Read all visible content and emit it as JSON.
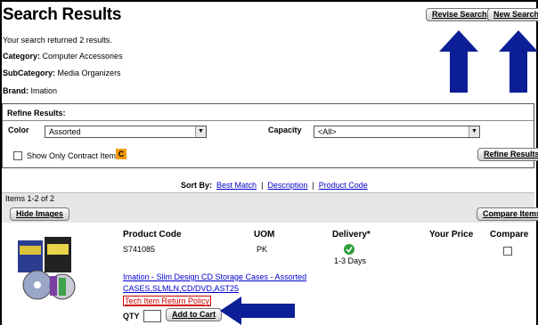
{
  "header": {
    "title": "Search Results",
    "revise_label": "Revise Search",
    "new_label": "New Search"
  },
  "summary": {
    "returned_text": "Your search returned 2 results.",
    "category_label": "Category:",
    "category_value": "Computer Accessories",
    "subcategory_label": "SubCategory:",
    "subcategory_value": "Media Organizers",
    "brand_label": "Brand:",
    "brand_value": "Imation"
  },
  "refine": {
    "title": "Refine Results:",
    "color_label": "Color",
    "color_value": "Assorted",
    "capacity_label": "Capacity",
    "capacity_value": "<All>",
    "contract_label": "Show Only Contract Items",
    "contract_badge": "C",
    "button_label": "Refine Results"
  },
  "sort": {
    "label": "Sort By:",
    "options": [
      "Best Match",
      "Description",
      "Product Code"
    ]
  },
  "results": {
    "count_text": "Items 1-2 of 2",
    "hide_images_label": "Hide Images",
    "compare_label": "Compare Items",
    "columns": [
      "Product Code",
      "UOM",
      "Delivery*",
      "Your Price",
      "Compare"
    ],
    "item": {
      "code": "S741085",
      "uom": "PK",
      "delivery": "1-3 Days",
      "name": "Imation - Slim Design CD Storage Cases - Assorted",
      "sku_line": "CASES,SLMLN,CD/DVD,AST25",
      "policy": "Tech Item Return Policy",
      "qty_label": "QTY",
      "add_label": "Add to Cart"
    }
  },
  "colors": {
    "arrow": "#0c1f96",
    "link": "#0000cc",
    "delivery_ok": "#2e9d3a",
    "badge": "#f39c12"
  }
}
